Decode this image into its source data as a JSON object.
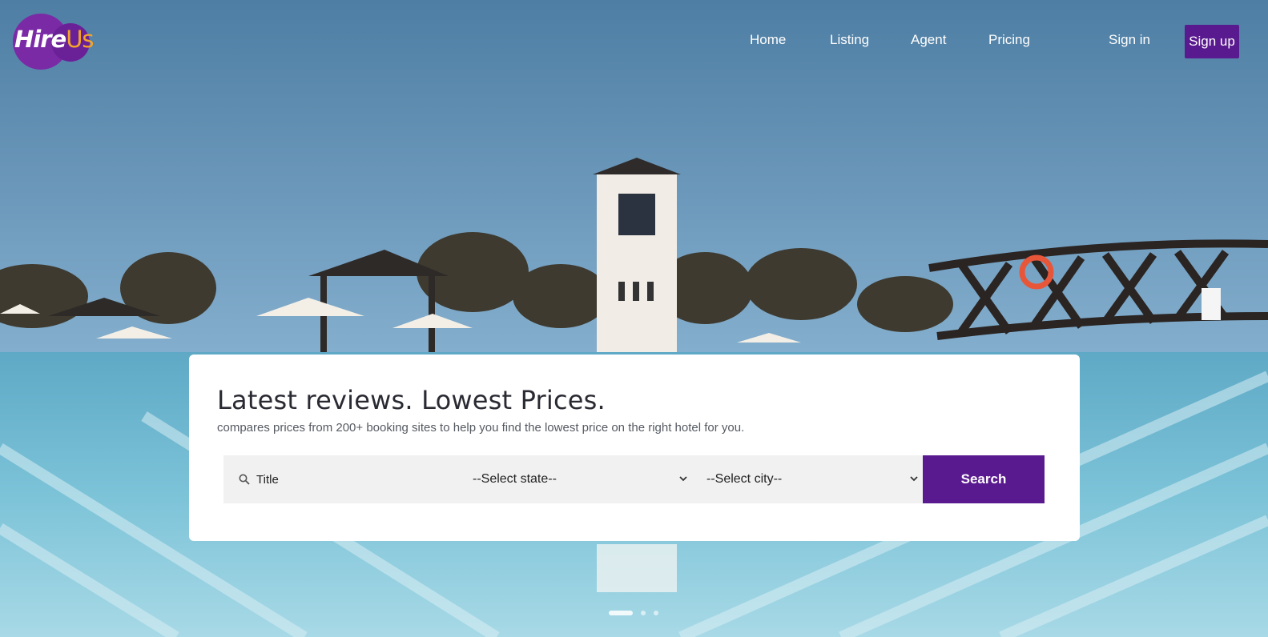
{
  "brand": {
    "part1": "Hire",
    "part2": "Us"
  },
  "nav": {
    "items": [
      {
        "label": "Home"
      },
      {
        "label": "Listing"
      },
      {
        "label": "Agent"
      },
      {
        "label": "Pricing"
      }
    ],
    "signin": "Sign in",
    "signup": "Sign up"
  },
  "hero": {
    "headline": "Latest reviews. Lowest Prices.",
    "subheadline": "compares prices from 200+ booking sites to help you find the lowest price on the right hotel for you."
  },
  "search": {
    "title_placeholder": "Title",
    "state_selected": "--Select state--",
    "city_selected": "--Select city--",
    "button": "Search",
    "icon": "search-icon"
  },
  "carousel": {
    "slides": 3,
    "active_index": 0
  },
  "colors": {
    "brand_purple": "#5a1a8f",
    "logo_orange": "#f4a428"
  }
}
